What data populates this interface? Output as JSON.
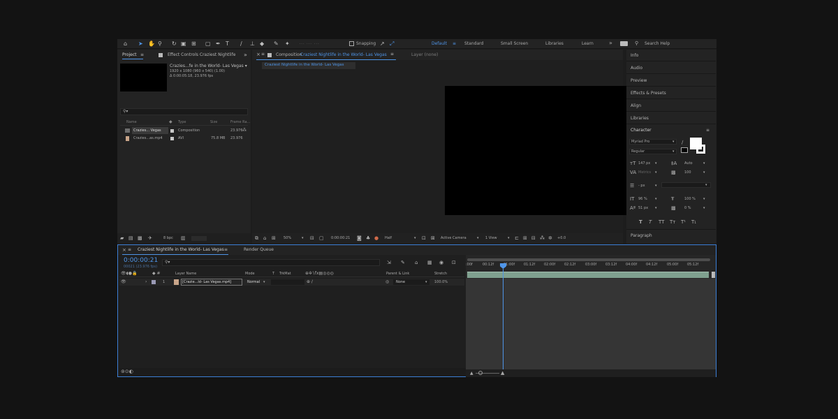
{
  "toolbar": {
    "snapping_label": "Snapping",
    "workspaces": [
      "Default",
      "Standard",
      "Small Screen",
      "Libraries",
      "Learn"
    ],
    "active_workspace": "Default",
    "search_placeholder": "Search Help"
  },
  "project_panel": {
    "tab_project": "Project",
    "tab_effect_controls": "Effect Controls Craziest Nightlife",
    "thumb_title": "Crazies...fe in the World- Las Vegas ▾",
    "thumb_line1": "1920 x 1080  (960 x 540) (1.00)",
    "thumb_line2": "Δ 0:00:05:18, 23.976 fps",
    "columns": [
      "Name",
      "Type",
      "Size",
      "Frame Ra..."
    ],
    "items": [
      {
        "name": "Crazies... Vegas",
        "type": "Composition",
        "size": "",
        "fps": "23.976"
      },
      {
        "name": "Crazies...as.mp4",
        "type": "AVI",
        "size": "75.8 MB",
        "fps": "23.976"
      }
    ],
    "bpc": "8 bpc"
  },
  "composition_panel": {
    "tab_label": "Composition",
    "comp_name": "Craziest Nightlife in the World- Las Vegas",
    "layer_tab": "Layer  (none)",
    "subtab": "Craziest Nightlife in the World- Las Vegas",
    "zoom": "50%",
    "timecode": "0:00:00:21",
    "resolution": "Half",
    "camera": "Active Camera",
    "view": "1 View",
    "exposure": "+0.0"
  },
  "right_panel": {
    "items": [
      "Info",
      "Audio",
      "Preview",
      "Effects & Presets",
      "Align",
      "Libraries"
    ],
    "character_title": "Character",
    "font": "Myriad Pro",
    "style": "Regular",
    "size": "147 px",
    "leading": "Auto",
    "kerning": "Metrics",
    "tracking": "100",
    "stroke_unit": "- px",
    "vscale": "96 %",
    "hscale": "100 %",
    "baseline": "51 px",
    "tsume": "0 %",
    "style_buttons": [
      "T",
      "T",
      "TT",
      "Tт",
      "T¹",
      "T₁"
    ],
    "paragraph_title": "Paragraph"
  },
  "timeline": {
    "tab_comp": "Craziest Nightlife in the World- Las Vegas",
    "tab_render": "Render Queue",
    "current_time": "0:00:00:21",
    "frame_info": "00021 (23.976 fps)",
    "columns": {
      "layer_name": "Layer Name",
      "mode": "Mode",
      "t": "T",
      "trkmat": "TrkMat",
      "parent": "Parent & Link",
      "stretch": "Stretch"
    },
    "layer": {
      "index": "1",
      "name": "[Crazie...ld- Las Vegas.mp4]",
      "mode": "Normal",
      "parent": "None",
      "stretch": "100.0%"
    },
    "ruler_labels": [
      ":00f",
      "00:12f",
      "01:00f",
      "01:12f",
      "02:00f",
      "02:12f",
      "03:00f",
      "03:12f",
      "04:00f",
      "04:12f",
      "05:00f",
      "05:12f"
    ]
  },
  "colors": {
    "accent": "#4f95e8",
    "clip": "#7fa08f",
    "background": "#1d1d1d"
  }
}
